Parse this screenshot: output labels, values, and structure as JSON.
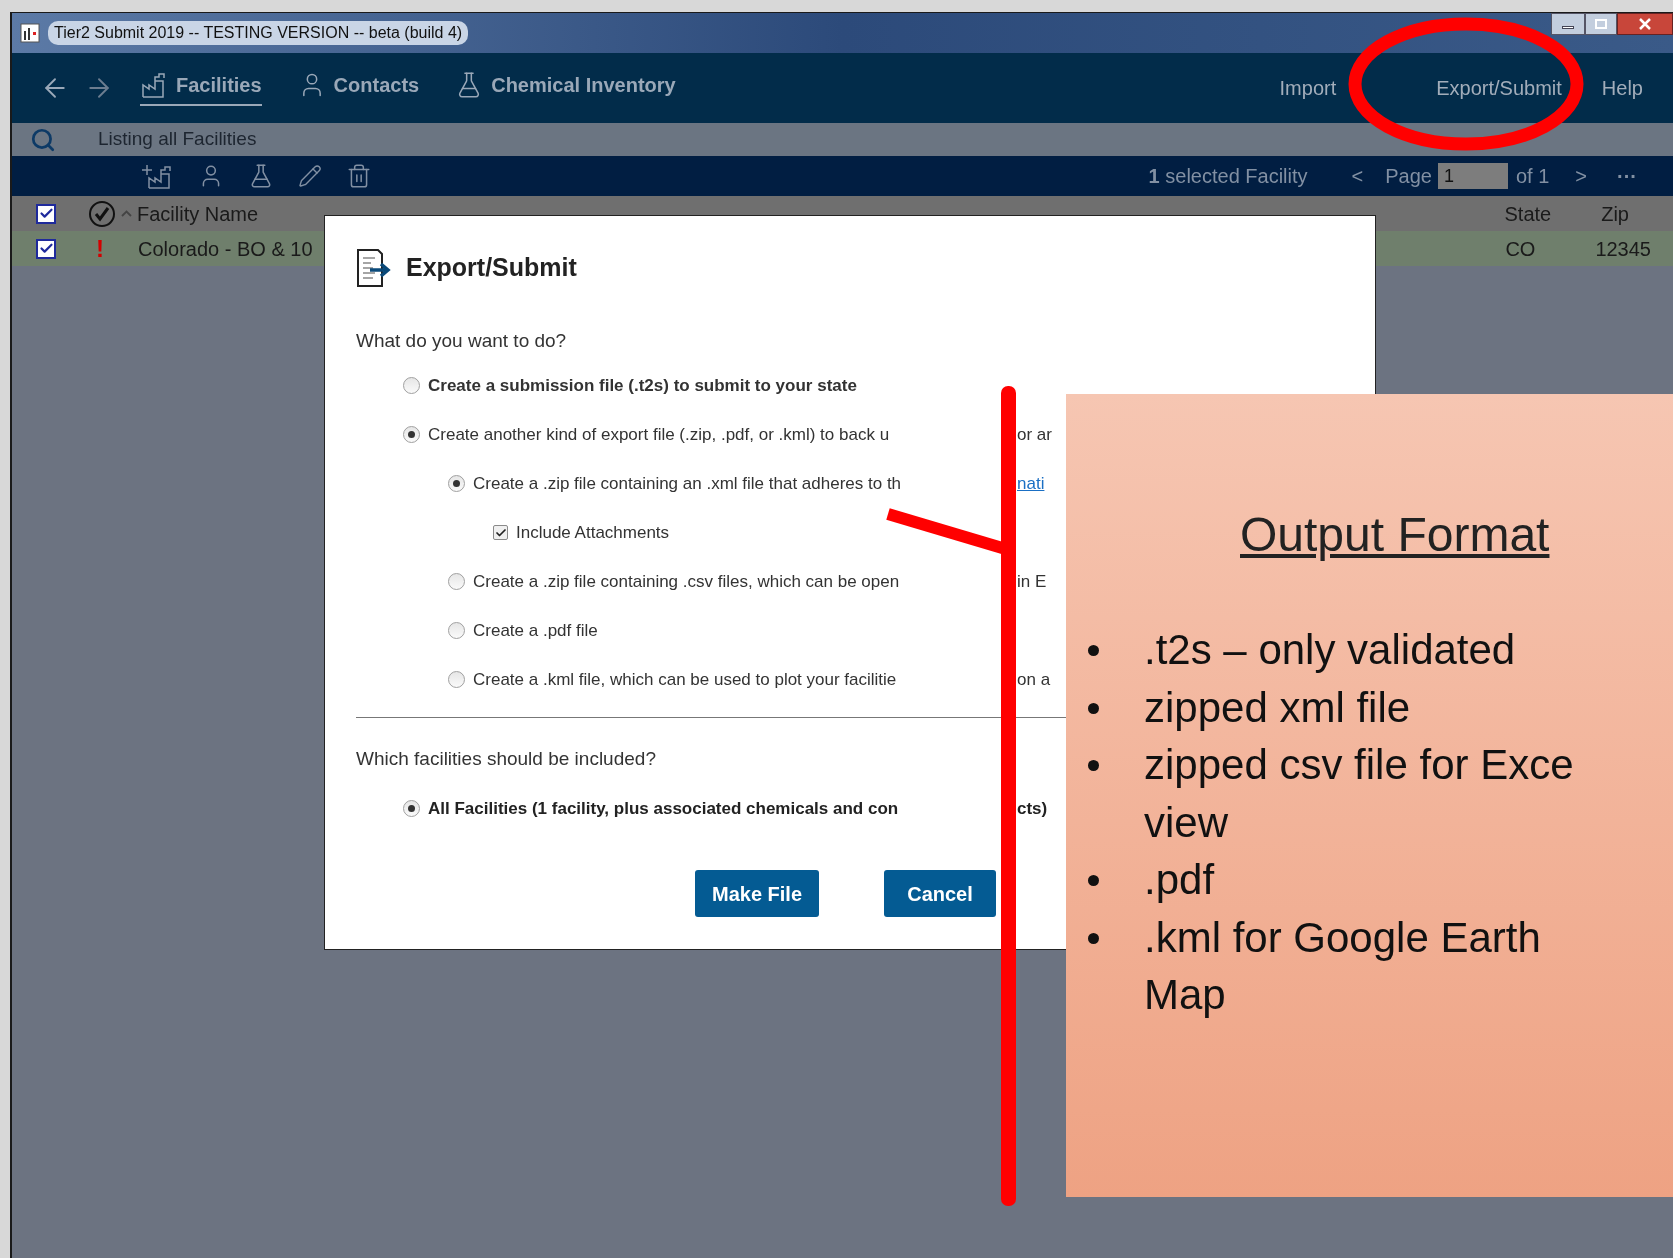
{
  "window": {
    "title": "Tier2 Submit 2019 -- TESTING VERSION -- beta (build 4)"
  },
  "nav": {
    "tabs": [
      {
        "label": "Facilities",
        "kind": "facility",
        "selected": true
      },
      {
        "label": "Contacts",
        "kind": "contact",
        "selected": false
      },
      {
        "label": "Chemical Inventory",
        "kind": "chemical",
        "selected": false
      }
    ],
    "actions": [
      "Import",
      "Export/Submit",
      "Help"
    ]
  },
  "search": {
    "text": "Listing all Facilities"
  },
  "toolbar": {
    "selection": "**1** selected Facility",
    "prev": "<",
    "page_label": "Page",
    "page": "1",
    "page_total": "of 1",
    "next": ">",
    "more": "···"
  },
  "table": {
    "header_checked": true,
    "columns": [
      "Facility Name",
      "State",
      "Zip"
    ],
    "rows": [
      {
        "checked": true,
        "flag": "!",
        "name": "Colorado - BO & 10",
        "state": "CO",
        "zip": "12345"
      }
    ]
  },
  "dialog": {
    "title": "Export/Submit",
    "question": "What do you want to do?",
    "options": [
      {
        "label": "Create a submission file (.t2s) to submit to your state",
        "emphasized": true,
        "selected": false
      },
      {
        "label": "Create another kind of export file (.zip, .pdf, or .kml) to back u",
        "tail": "or ar",
        "emphasized": false,
        "selected": true,
        "children": [
          {
            "label": "Create a .zip file containing an .xml file that adheres to th",
            "link": "nati",
            "selected": true,
            "checkbox": {
              "label": "Include Attachments",
              "checked": true
            }
          },
          {
            "label": "Create a .zip file containing .csv files, which can be open",
            "tail": "in E",
            "selected": false
          },
          {
            "label": "Create a .pdf file",
            "selected": false
          },
          {
            "label": "Create a .kml file, which can be used to plot your facilitie",
            "tail": "on a",
            "selected": false
          }
        ]
      }
    ],
    "scope_question": "Which facilities should be included?",
    "scope_options": [
      {
        "label": "All Facilities (1 facility, plus associated chemicals and con",
        "tail": "cts)",
        "emphasized": true,
        "selected": true
      }
    ],
    "buttons": [
      "Make File",
      "Cancel"
    ]
  },
  "annotation": {
    "title": "Output Format",
    "bullets": [
      {
        "lines": [
          ".t2s – only validated"
        ]
      },
      {
        "lines": [
          "zipped xml file"
        ]
      },
      {
        "lines": [
          "zipped csv file for Exce",
          "view"
        ]
      },
      {
        "lines": [
          ".pdf"
        ]
      },
      {
        "lines": [
          ".kml for Google Earth",
          "Map"
        ]
      }
    ]
  }
}
